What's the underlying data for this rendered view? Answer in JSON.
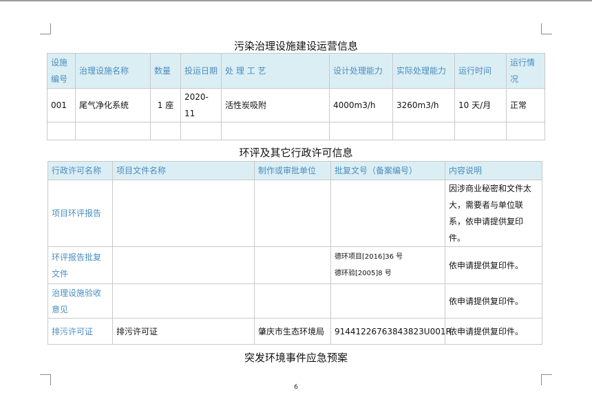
{
  "section1": {
    "title": "污染治理设施建设运营信息",
    "headers": {
      "code": "设施编号",
      "name": "治理设施名称",
      "qty": "数量",
      "date": "投运日期",
      "process": "处 理 工 艺",
      "design_cap": "设计处理能力",
      "actual_cap": "实际处理能力",
      "run_time": "运行时间",
      "status": "运行情况"
    },
    "rows": [
      {
        "code": "001",
        "name": "尾气净化系统",
        "qty": "1 座",
        "date": "2020-11",
        "process": "活性炭吸附",
        "design_cap": "4000m3/h",
        "actual_cap": "3260m3/h",
        "run_time": "10 天/月",
        "status": "正常"
      }
    ]
  },
  "section2": {
    "title": "环评及其它行政许可信息",
    "headers": {
      "permit": "行政许可名称",
      "doc": "项目文件名称",
      "unit": "制作或审批单位",
      "number": "批复文号（备案编号）",
      "desc": "内容说明"
    },
    "rows": [
      {
        "permit": "项目环评报告",
        "doc": "",
        "unit": "",
        "number": "",
        "desc": "因涉商业秘密和文件太大，需要者与单位联系，依申请提供复印件。"
      },
      {
        "permit": "环评报告批复文件",
        "doc": "",
        "unit": "",
        "number_line1": "德环项目[2016]36 号",
        "number_line2": "德环验[2005]8 号",
        "desc": "依申请提供复印件。"
      },
      {
        "permit": "治理设施验收意见",
        "doc": "",
        "unit": "",
        "number": "",
        "desc": "依申请提供复印件。"
      },
      {
        "permit": "排污许可证",
        "doc": "排污许可证",
        "unit": "肇庆市生态环境局",
        "number": "91441226763843823U001R",
        "desc": "依申请提供复印件。"
      }
    ]
  },
  "section3": {
    "title": "突发环境事件应急预案"
  },
  "page_number": "6",
  "colors": {
    "header_bg": "#dbeef4",
    "header_text": "#4a8dbf",
    "border": "#c9c9c9"
  }
}
